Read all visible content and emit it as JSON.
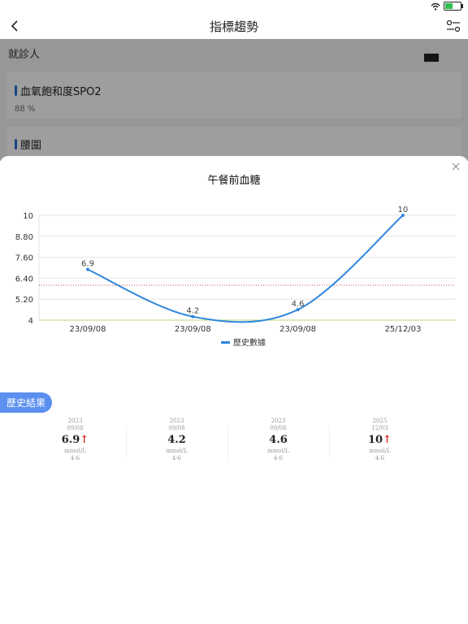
{
  "header": {
    "title": "指標趨勢"
  },
  "background": {
    "patient_label": "就診人",
    "cards": [
      {
        "title": "血氧飽和度SPO2",
        "value": "88 %"
      },
      {
        "title": "腰圍",
        "value": ""
      }
    ]
  },
  "sheet": {
    "title": "午餐前血糖",
    "history_label": "歷史結果"
  },
  "chart_data": {
    "type": "line",
    "categories": [
      "23/09/08",
      "23/09/08",
      "23/09/08",
      "25/12/03"
    ],
    "series": [
      {
        "name": "歷史數據",
        "values": [
          6.9,
          4.2,
          4.6,
          10
        ],
        "labels": [
          "6.9",
          "4.2",
          "4.6",
          "10"
        ],
        "color": "#2e86de"
      }
    ],
    "y_ticks": [
      "10",
      "8.80",
      "7.60",
      "6.40",
      "5.20",
      "4"
    ],
    "ylim": [
      4,
      10
    ],
    "reference_lines": [
      {
        "value": 6,
        "color": "#c0504d",
        "style": "dotted"
      },
      {
        "value": 4,
        "color": "#b7d77a",
        "style": "solid"
      }
    ],
    "grid": true,
    "legend": "bottom"
  },
  "results": [
    {
      "year": "2023",
      "date": "09/08",
      "value": "6.9",
      "arrow": "↑",
      "unit": "mmol/L",
      "range": "4-6"
    },
    {
      "year": "2023",
      "date": "09/08",
      "value": "4.2",
      "arrow": "",
      "unit": "mmol/L",
      "range": "4-6"
    },
    {
      "year": "2023",
      "date": "09/08",
      "value": "4.6",
      "arrow": "",
      "unit": "mmol/L",
      "range": "4-6"
    },
    {
      "year": "2025",
      "date": "12/03",
      "value": "10",
      "arrow": "↑",
      "unit": "mmol/L",
      "range": "4-6"
    }
  ]
}
